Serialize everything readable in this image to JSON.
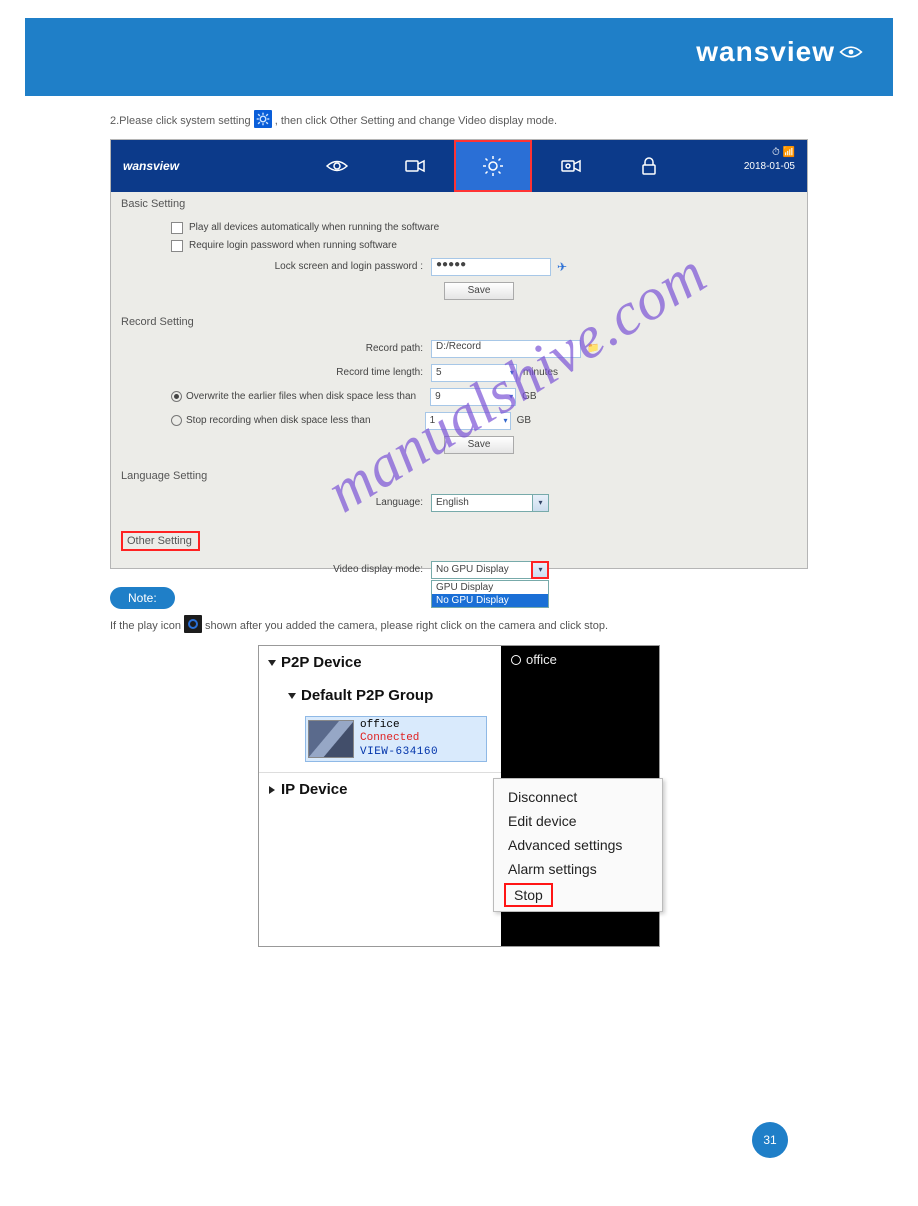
{
  "banner": {
    "brand": "wansview"
  },
  "instr": "2.Please click system setting   , then click Other Setting and change Video display mode.",
  "topbar": {
    "brand": "wansview",
    "date": "2018-01-05",
    "time_icons": "⏱ 📶"
  },
  "basic": {
    "title": "Basic Setting",
    "opt1": "Play all devices automatically when running the software",
    "opt2": "Require login password when running software",
    "pwd_label": "Lock screen and login password :",
    "pwd_value": "●●●●●",
    "save": "Save"
  },
  "record": {
    "title": "Record Setting",
    "path_label": "Record path:",
    "path_value": "D:/Record",
    "len_label": "Record time length:",
    "len_value": "5",
    "len_unit": "minutes",
    "ow_label": "Overwrite the earlier files when disk space less than",
    "ow_value": "9",
    "ow_unit": "GB",
    "stop_label": "Stop recording when disk space less than",
    "stop_value": "1",
    "stop_unit": "GB",
    "save": "Save"
  },
  "lang": {
    "title": "Language Setting",
    "label": "Language:",
    "value": "English"
  },
  "other": {
    "title": "Other Setting",
    "mode_label": "Video display mode:",
    "mode_value": "No GPU Display",
    "opt_gpu": "GPU Display",
    "opt_nogpu": "No GPU Display"
  },
  "note_pill": "Note:",
  "note": "If the play icon   shown after you added the camera, please right click on the camera and click stop.",
  "tree": {
    "p2p": "P2P Device",
    "group": "Default P2P Group",
    "cam_name": "office",
    "cam_state": "Connected",
    "cam_id": "VIEW-634160",
    "ip": "IP Device"
  },
  "preview_label": "office",
  "ctx": {
    "disconnect": "Disconnect",
    "edit": "Edit device",
    "adv": "Advanced settings",
    "alarm": "Alarm settings",
    "stop": "Stop"
  },
  "watermark": "manualshive.com",
  "page_no": "31"
}
